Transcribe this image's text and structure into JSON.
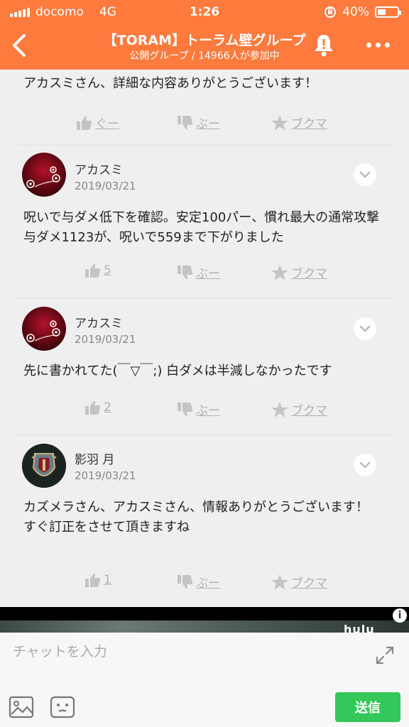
{
  "status_bar": {
    "carrier": "docomo",
    "network": "4G",
    "time": "1:26",
    "battery": "40%"
  },
  "header": {
    "title": "【TORAM】トーラム壁グループ",
    "subtitle": "公開グループ / 14966人が参加中",
    "accent_color": "#ff7a3d"
  },
  "posts": [
    {
      "body": "アカスミさん、詳細な内容ありがとうございます！",
      "like": "ぐー",
      "dislike": "ぶー",
      "bookmark": "ブクマ"
    },
    {
      "name": "アカスミ",
      "date": "2019/03/21",
      "avatar": "flower-avatar",
      "body": "呪いで与ダメ低下を確認。安定100パー、慣れ最大の通常攻撃与ダメ1123が、呪いで559まで下がりました",
      "like": "5",
      "dislike": "ぶー",
      "bookmark": "ブクマ"
    },
    {
      "name": "アカスミ",
      "date": "2019/03/21",
      "avatar": "flower-avatar",
      "body": "先に書かれてた(￣▽￣;) 白ダメは半減しなかったです",
      "like": "2",
      "dislike": "ぶー",
      "bookmark": "ブクマ"
    },
    {
      "name": "影羽 月",
      "date": "2019/03/21",
      "avatar": "shield-avatar",
      "body": "カズメラさん、アカスミさん、情報ありがとうございます！\nすぐ訂正をさせて頂きますね",
      "like": "1",
      "dislike": "ぶー",
      "bookmark": "ブクマ"
    }
  ],
  "ad": {
    "brand": "hulu",
    "info": "i"
  },
  "composer": {
    "placeholder": "チャットを入力",
    "send_label": "送信",
    "send_color": "#34c759"
  }
}
